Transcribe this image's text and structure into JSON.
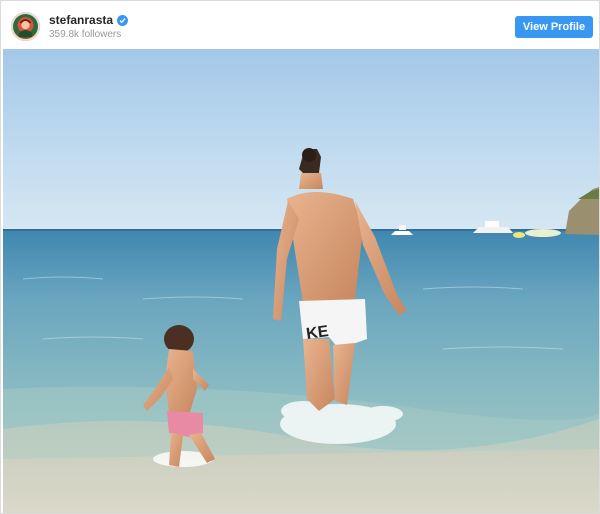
{
  "post": {
    "username": "stefanrasta",
    "followers": "359.8k followers",
    "view_profile_label": "View Profile"
  },
  "colors": {
    "accent": "#3897f0",
    "sky": "#a9cde9",
    "sea": "#6fa9bd",
    "sand": "#d9d3c4"
  },
  "icons": {
    "verified": "verified-badge-icon",
    "avatar": "profile-avatar"
  }
}
